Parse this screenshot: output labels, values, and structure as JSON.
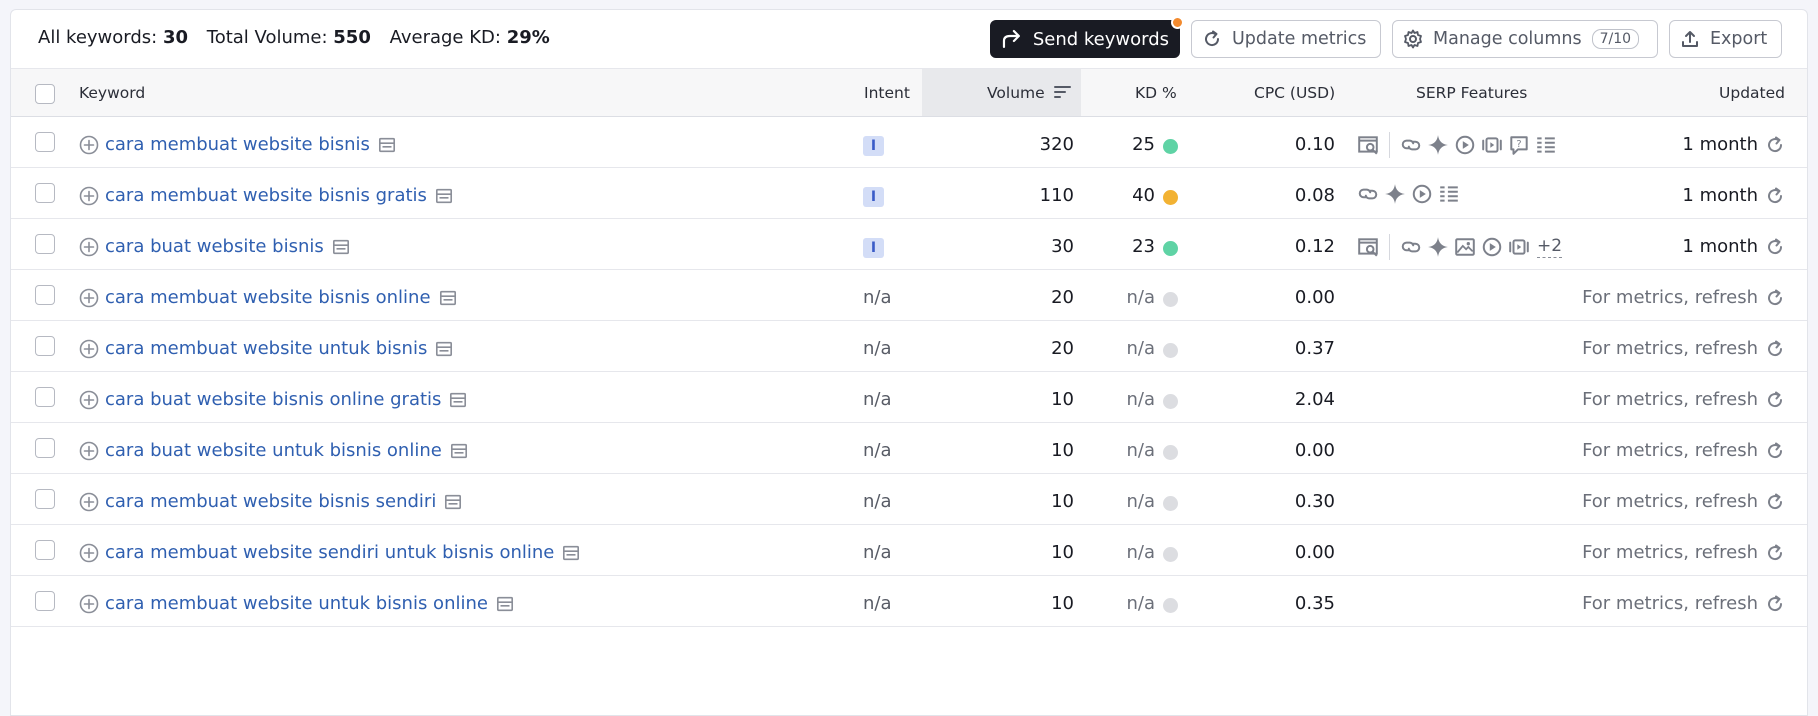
{
  "summary": {
    "all_keywords_label": "All keywords:",
    "all_keywords_value": "30",
    "total_volume_label": "Total Volume:",
    "total_volume_value": "550",
    "avg_kd_label": "Average KD:",
    "avg_kd_value": "29%"
  },
  "toolbar": {
    "send_label": "Send keywords",
    "update_label": "Update metrics",
    "manage_label": "Manage columns",
    "manage_count": "7/10",
    "export_label": "Export"
  },
  "columns": {
    "keyword": "Keyword",
    "intent": "Intent",
    "volume": "Volume",
    "kd": "KD %",
    "cpc": "CPC (USD)",
    "serp": "SERP Features",
    "updated": "Updated"
  },
  "colors": {
    "kd_easy": "#5fd3a5",
    "kd_medium": "#f2b233",
    "kd_unknown": "#dcdde1",
    "link": "#2f5fb0"
  },
  "rows": [
    {
      "keyword": "cara membuat website bisnis",
      "intent": "I",
      "volume": "320",
      "kd": "25",
      "kd_level": "easy",
      "cpc": "0.10",
      "serp": [
        "sitelinks-search-icon",
        "|",
        "link-icon",
        "ai-overview-icon",
        "video-icon",
        "video-carousel-icon",
        "faq-icon",
        "table-icon"
      ],
      "serp_more": "",
      "updated": "1 month"
    },
    {
      "keyword": "cara membuat website bisnis gratis",
      "intent": "I",
      "volume": "110",
      "kd": "40",
      "kd_level": "medium",
      "cpc": "0.08",
      "serp": [
        "link-icon",
        "ai-overview-icon",
        "video-icon",
        "table-icon"
      ],
      "serp_more": "",
      "updated": "1 month"
    },
    {
      "keyword": "cara buat website bisnis",
      "intent": "I",
      "volume": "30",
      "kd": "23",
      "kd_level": "easy",
      "cpc": "0.12",
      "serp": [
        "sitelinks-search-icon",
        "|",
        "link-icon",
        "ai-overview-icon",
        "image-icon",
        "video-icon",
        "video-carousel-icon"
      ],
      "serp_more": "+2",
      "updated": "1 month"
    },
    {
      "keyword": "cara membuat website bisnis online",
      "intent": "n/a",
      "volume": "20",
      "kd": "n/a",
      "kd_level": "unknown",
      "cpc": "0.00",
      "serp": [],
      "serp_more": "",
      "updated": "For metrics, refresh"
    },
    {
      "keyword": "cara membuat website untuk bisnis",
      "intent": "n/a",
      "volume": "20",
      "kd": "n/a",
      "kd_level": "unknown",
      "cpc": "0.37",
      "serp": [],
      "serp_more": "",
      "updated": "For metrics, refresh"
    },
    {
      "keyword": "cara buat website bisnis online gratis",
      "intent": "n/a",
      "volume": "10",
      "kd": "n/a",
      "kd_level": "unknown",
      "cpc": "2.04",
      "serp": [],
      "serp_more": "",
      "updated": "For metrics, refresh"
    },
    {
      "keyword": "cara buat website untuk bisnis online",
      "intent": "n/a",
      "volume": "10",
      "kd": "n/a",
      "kd_level": "unknown",
      "cpc": "0.00",
      "serp": [],
      "serp_more": "",
      "updated": "For metrics, refresh"
    },
    {
      "keyword": "cara membuat website bisnis sendiri",
      "intent": "n/a",
      "volume": "10",
      "kd": "n/a",
      "kd_level": "unknown",
      "cpc": "0.30",
      "serp": [],
      "serp_more": "",
      "updated": "For metrics, refresh"
    },
    {
      "keyword": "cara membuat website sendiri untuk bisnis online",
      "intent": "n/a",
      "volume": "10",
      "kd": "n/a",
      "kd_level": "unknown",
      "cpc": "0.00",
      "serp": [],
      "serp_more": "",
      "updated": "For metrics, refresh"
    },
    {
      "keyword": "cara membuat website untuk bisnis online",
      "intent": "n/a",
      "volume": "10",
      "kd": "n/a",
      "kd_level": "unknown",
      "cpc": "0.35",
      "serp": [],
      "serp_more": "",
      "updated": "For metrics, refresh"
    }
  ]
}
